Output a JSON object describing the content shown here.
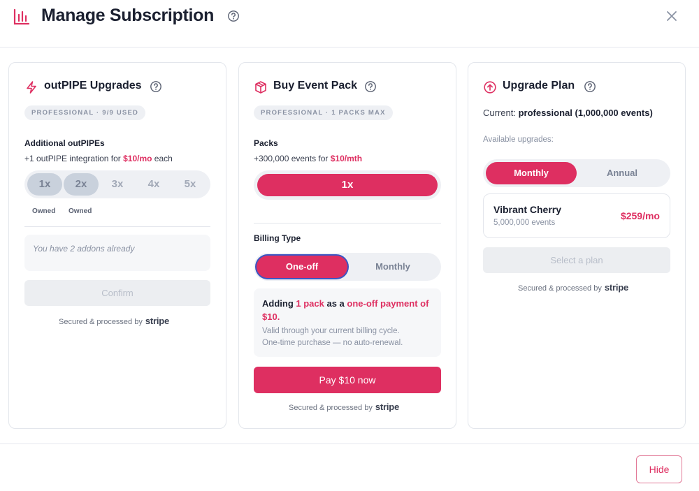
{
  "header": {
    "title": "Manage Subscription",
    "close_label": "×"
  },
  "outpipe": {
    "title": "outPIPE Upgrades",
    "badge": "PROFESSIONAL · 9/9 USED",
    "additional_label": "Additional outPIPEs",
    "price_prefix": "+1 outPIPE integration for ",
    "price": "$10/mo",
    "price_suffix": " each",
    "options": [
      {
        "label": "1x",
        "owned": true
      },
      {
        "label": "2x",
        "owned": true
      },
      {
        "label": "3x",
        "owned": false
      },
      {
        "label": "4x",
        "owned": false
      },
      {
        "label": "5x",
        "owned": false
      }
    ],
    "owned_label": "Owned",
    "notice": "You have 2 addons already",
    "confirm_label": "Confirm",
    "secured_text": "Secured & processed by",
    "stripe": "stripe"
  },
  "eventpack": {
    "title": "Buy Event Pack",
    "badge": "PROFESSIONAL · 1 PACKS MAX",
    "packs_label": "Packs",
    "price_prefix": "+300,000 events for ",
    "price": "$10/mth",
    "pack_option": "1x",
    "billing_label": "Billing Type",
    "billing_options": [
      "One-off",
      "Monthly"
    ],
    "summary_adding": "Adding ",
    "summary_pack": "1 pack",
    "summary_as": " as a ",
    "summary_payment": "one-off payment of $10.",
    "summary_note1": "Valid through your current billing cycle.",
    "summary_note2": "One-time purchase — no auto-renewal.",
    "pay_label": "Pay $10 now",
    "secured_text": "Secured & processed by",
    "stripe": "stripe"
  },
  "upgrade": {
    "title": "Upgrade Plan",
    "current_prefix": "Current: ",
    "current_plan": "professional (1,000,000 events)",
    "available_label": "Available upgrades:",
    "cycle_options": [
      "Monthly",
      "Annual"
    ],
    "plan_name": "Vibrant Cherry",
    "plan_events": "5,000,000 events",
    "plan_price": "$259/mo",
    "select_label": "Select a plan",
    "secured_text": "Secured & processed by",
    "stripe": "stripe"
  },
  "footer": {
    "hide_label": "Hide"
  },
  "colors": {
    "accent": "#de2f61",
    "text": "#1b2030",
    "muted": "#8a92a3",
    "focus_ring": "#3a56c4"
  }
}
